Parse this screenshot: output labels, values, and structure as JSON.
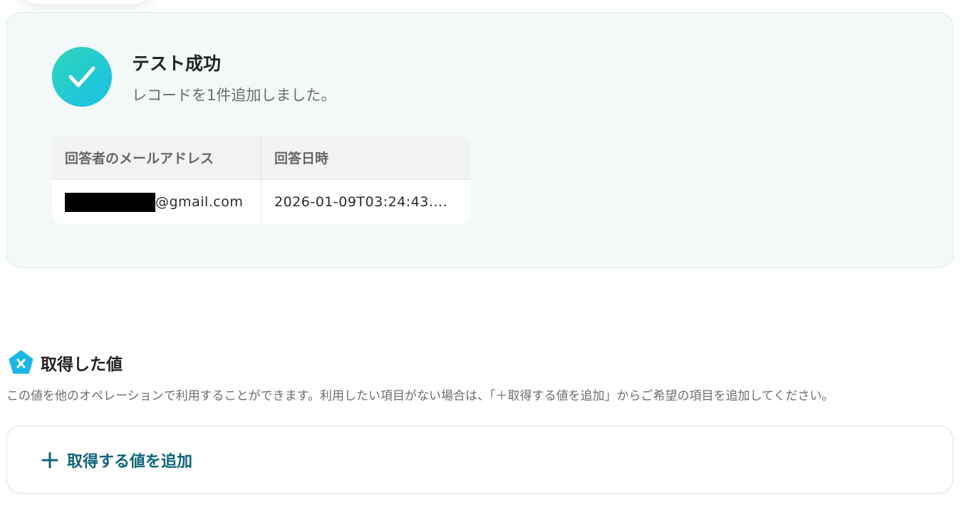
{
  "result": {
    "title": "テスト成功",
    "message": "レコードを1件追加しました。",
    "table": {
      "headers": [
        "回答者のメールアドレス",
        "回答日時"
      ],
      "rows": [
        {
          "email_visible": "@gmail.com",
          "datetime": "2026-01-09T03:24:43...."
        }
      ]
    }
  },
  "acquired": {
    "title": "取得した値",
    "description": "この値を他のオペレーションで利用することができます。利用したい項目がない場合は、「＋取得する値を追加」からご希望の項目を追加してください。",
    "add_button_label": "取得する値を追加"
  },
  "colors": {
    "success_gradient_start": "#2fd5b9",
    "success_gradient_end": "#19c0e8",
    "panel_bg": "#f2f9f8",
    "accent_text": "#0e6478",
    "value_icon": "#1ab7e6"
  },
  "icons": {
    "success": "check-icon",
    "section": "variable-icon",
    "add": "plus-icon"
  }
}
